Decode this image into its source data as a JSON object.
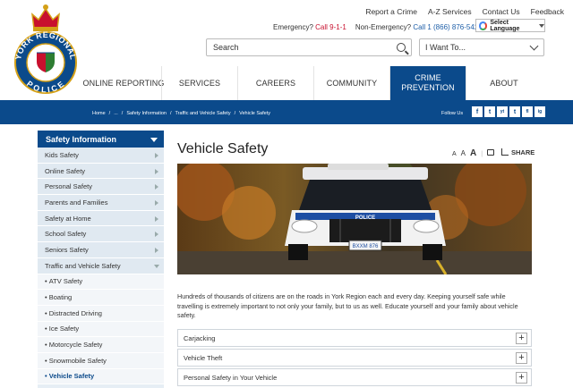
{
  "top_links": [
    "Report a Crime",
    "A-Z Services",
    "Contact Us",
    "Feedback"
  ],
  "emergency": {
    "label": "Emergency?",
    "number": "Call 9-1-1",
    "non_label": "Non-Emergency?",
    "non_number": "Call 1 (866) 876-5423"
  },
  "language": {
    "label": "Select Language",
    "icon": "google-icon"
  },
  "logo": {
    "text_top": "YORK REGIONAL",
    "text_bottom": "POLICE"
  },
  "search": {
    "placeholder": "Search",
    "icon": "search-icon"
  },
  "iwant": {
    "label": "I Want To...",
    "icon": "chevron-down-icon"
  },
  "nav": [
    {
      "label": "ONLINE REPORTING"
    },
    {
      "label": "SERVICES"
    },
    {
      "label": "CAREERS"
    },
    {
      "label": "COMMUNITY"
    },
    {
      "label": "CRIME PREVENTION",
      "active": true
    },
    {
      "label": "ABOUT"
    }
  ],
  "breadcrumb": [
    "Home",
    "/",
    "...",
    "/",
    "Safety Information",
    "/",
    "Traffic and Vehicle Safety",
    "/",
    "Vehicle Safety"
  ],
  "follow_label": "Follow Us",
  "socials": [
    "f",
    "t",
    "yt",
    "t",
    "fl",
    "ig"
  ],
  "sidebar": {
    "heading": "Safety Information",
    "items": [
      "Kids Safety",
      "Online Safety",
      "Personal Safety",
      "Parents and Families",
      "Safety at Home",
      "School Safety",
      "Seniors Safety",
      "Traffic and Vehicle Safety"
    ],
    "subitems": [
      "ATV Safety",
      "Boating",
      "Distracted Driving",
      "Ice Safety",
      "Motorcycle Safety",
      "Snowmobile Safety",
      "Vehicle Safety"
    ],
    "bullet": "•"
  },
  "page": {
    "title": "Vehicle Safety",
    "font_sizes": [
      "A",
      "A",
      "A"
    ],
    "share_label": "SHARE",
    "hero": {
      "car_badge": "POLICE",
      "plate": "BXXM 876"
    },
    "intro": "Hundreds of thousands of citizens are on the roads in York Region each and every day. Keeping yourself safe while travelling is extremely important to not only your family, but to us as well. Educate yourself and your family about vehicle safety.",
    "accordions": [
      "Carjacking",
      "Vehicle Theft",
      "Personal Safety in Your Vehicle"
    ],
    "plus": "+"
  },
  "colors": {
    "brand_blue": "#0b4a8b",
    "emergency_red": "#c8102e"
  }
}
